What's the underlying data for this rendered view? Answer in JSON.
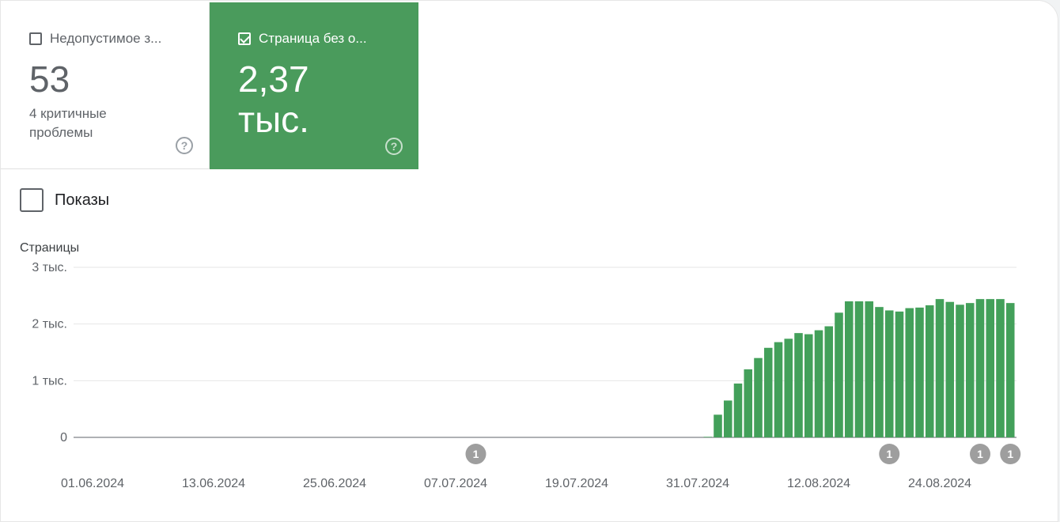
{
  "tiles": [
    {
      "label": "Недопустимое з...",
      "value": "53",
      "sub": "4 критичные проблемы",
      "help": "?"
    },
    {
      "label": "Страница без о...",
      "value": "2,37 тыс.",
      "help": "?"
    }
  ],
  "toggle": {
    "label": "Показы"
  },
  "colors": {
    "bar": "#43a05a",
    "tile_active": "#4a9b5c",
    "grid": "#e6e6e6",
    "annotation": "#9e9e9e"
  },
  "chart_data": {
    "type": "bar",
    "ylabel": "Страницы",
    "ylim": [
      0,
      3000
    ],
    "ytick_values": [
      0,
      1000,
      2000,
      3000
    ],
    "ytick_labels": [
      "0",
      "1 тыс.",
      "2 тыс.",
      "3 тыс."
    ],
    "x_tick_labels": [
      "01.06.2024",
      "13.06.2024",
      "25.06.2024",
      "07.07.2024",
      "19.07.2024",
      "31.07.2024",
      "12.08.2024",
      "24.08.2024"
    ],
    "x_tick_positions": [
      0,
      12,
      24,
      36,
      48,
      60,
      72,
      84
    ],
    "start_day": 0,
    "values": [
      0,
      0,
      0,
      0,
      0,
      0,
      0,
      0,
      0,
      0,
      0,
      0,
      0,
      0,
      0,
      0,
      0,
      0,
      0,
      0,
      0,
      0,
      0,
      0,
      0,
      0,
      0,
      0,
      0,
      0,
      0,
      0,
      0,
      0,
      0,
      0,
      0,
      0,
      0,
      0,
      0,
      0,
      0,
      0,
      0,
      0,
      0,
      0,
      0,
      0,
      0,
      0,
      0,
      0,
      0,
      0,
      0,
      0,
      0,
      0,
      0,
      10,
      400,
      650,
      950,
      1200,
      1400,
      1580,
      1680,
      1740,
      1840,
      1820,
      1890,
      1960,
      2200,
      2400,
      2400,
      2400,
      2300,
      2240,
      2220,
      2280,
      2290,
      2330,
      2440,
      2390,
      2340,
      2370,
      2440,
      2440,
      2440,
      2370
    ],
    "annotations": [
      {
        "x": 38,
        "label": "1"
      },
      {
        "x": 79,
        "label": "1"
      },
      {
        "x": 88,
        "label": "1"
      },
      {
        "x": 91,
        "label": "1"
      }
    ]
  }
}
